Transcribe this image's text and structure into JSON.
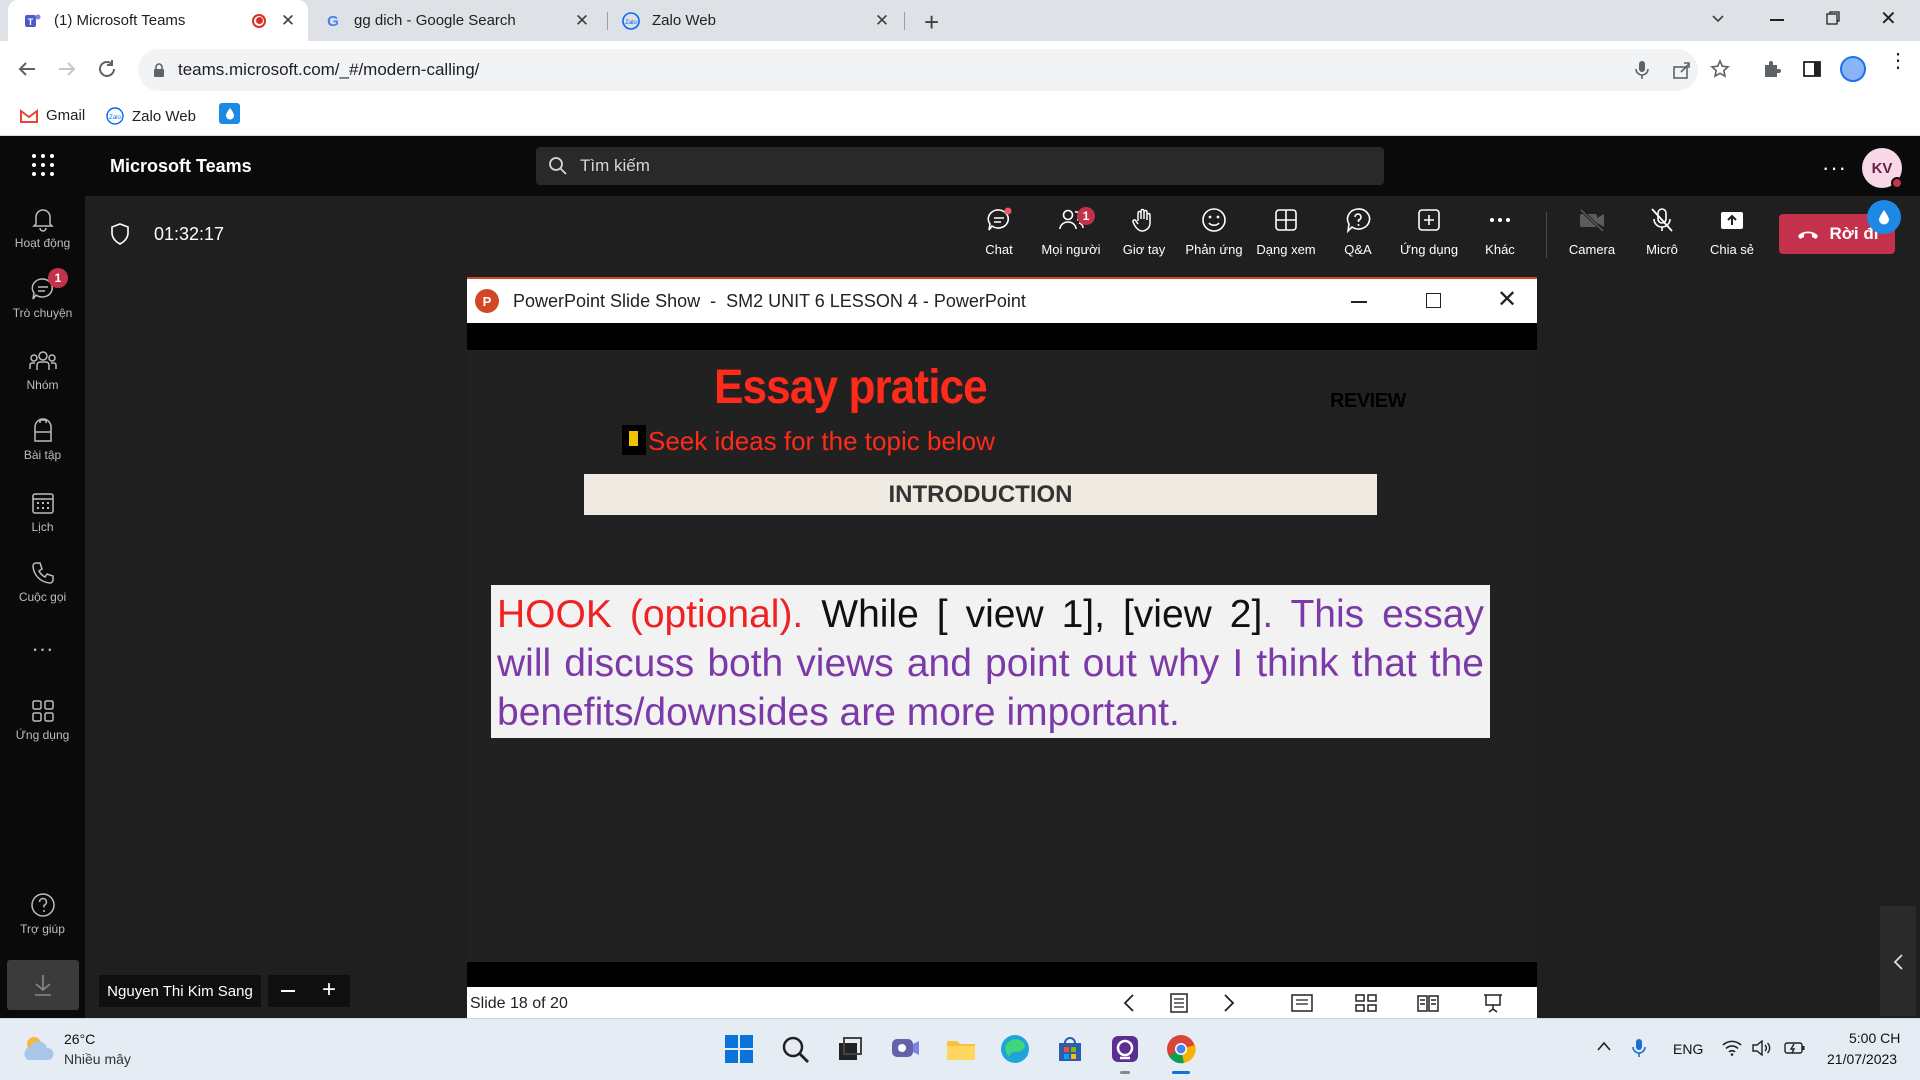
{
  "browser": {
    "tabs": [
      {
        "title": "(1) Microsoft Teams",
        "active": true
      },
      {
        "title": "gg dich - Google Search",
        "active": false
      },
      {
        "title": "Zalo Web",
        "active": false
      }
    ],
    "url": "teams.microsoft.com/_#/modern-calling/",
    "bookmarks": [
      "Gmail",
      "Zalo Web"
    ]
  },
  "teams": {
    "app_title": "Microsoft Teams",
    "search_placeholder": "Tìm kiếm",
    "avatar_initials": "KV",
    "rail": [
      {
        "label": "Hoạt động",
        "icon": "bell-icon"
      },
      {
        "label": "Trò chuyện",
        "icon": "chat-icon",
        "badge": "1"
      },
      {
        "label": "Nhóm",
        "icon": "teams-icon"
      },
      {
        "label": "Bài tập",
        "icon": "assignment-icon"
      },
      {
        "label": "Lịch",
        "icon": "calendar-icon"
      },
      {
        "label": "Cuộc gọi",
        "icon": "phone-icon"
      },
      {
        "label": "Ứng dụng",
        "icon": "apps-icon"
      },
      {
        "label": "Trợ giúp",
        "icon": "help-icon"
      }
    ]
  },
  "meeting": {
    "timer": "01:32:17",
    "controls": [
      {
        "label": "Chat",
        "icon": "chat-icon"
      },
      {
        "label": "Mọi người",
        "icon": "people-icon",
        "badge": "1"
      },
      {
        "label": "Giơ tay",
        "icon": "raise-hand-icon"
      },
      {
        "label": "Phản ứng",
        "icon": "smile-icon"
      },
      {
        "label": "Dạng xem",
        "icon": "layout-icon"
      },
      {
        "label": "Q&A",
        "icon": "qa-icon"
      },
      {
        "label": "Ứng dụng",
        "icon": "add-app-icon"
      },
      {
        "label": "Khác",
        "icon": "more-icon"
      },
      {
        "label": "Camera",
        "icon": "camera-off-icon"
      },
      {
        "label": "Micrô",
        "icon": "mic-off-icon"
      },
      {
        "label": "Chia sẻ",
        "icon": "share-icon"
      }
    ],
    "leave_label": "Rời đi",
    "participant_name": "Nguyen Thi Kim Sang"
  },
  "powerpoint": {
    "window_title": "PowerPoint Slide Show  -  SM2 UNIT 6 LESSON 4 - PowerPoint",
    "slide_status": "Slide 18 of 20",
    "slide": {
      "title": "Essay pratice",
      "review_label": "REVIEW",
      "subtitle": "Seek ideas for the topic below",
      "section": "INTRODUCTION",
      "hook": "HOOK (optional).",
      "views": " While [ view 1], [view 2]",
      "dot": ".",
      "thesis": " This essay will discuss both views and point out why I think that the benefits/downsides are more important."
    }
  },
  "taskbar": {
    "weather_temp": "26°C",
    "weather_desc": "Nhiều mây",
    "language": "ENG",
    "time": "5:00 CH",
    "date": "21/07/2023"
  }
}
